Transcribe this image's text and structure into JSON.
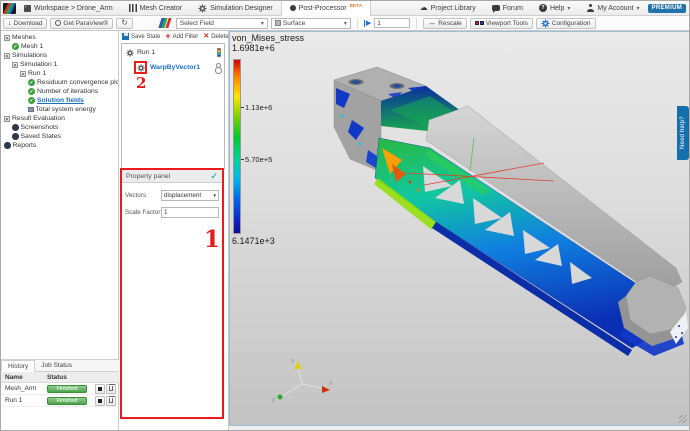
{
  "topbar": {
    "workspace_label": "Workspace > Drone_Arm",
    "tab_mesh_creator": "Mesh Creator",
    "tab_sim_designer": "Simulation Designer",
    "tab_post_processor": "Post-Processor",
    "beta_badge": "BETA",
    "project_library": "Project Library",
    "forum": "Forum",
    "help": "Help",
    "my_account": "My Account",
    "premium": "PREMIUM"
  },
  "toolbar": {
    "download": "Download",
    "get_paraview": "Get ParaView®",
    "select_field": "Select Field",
    "surface": "Surface",
    "frame_value": "1",
    "rescale": "Rescale",
    "viewport_tools": "Viewport Tools",
    "configuration": "Configuration"
  },
  "sidebar": {
    "items": [
      {
        "label": "Meshes",
        "level": 0,
        "icon": "expander"
      },
      {
        "label": "Mesh 1",
        "level": 1,
        "icon": "check"
      },
      {
        "label": "Simulations",
        "level": 0,
        "icon": "expander"
      },
      {
        "label": "Simulation 1",
        "level": 1,
        "icon": "expander"
      },
      {
        "label": "Run 1",
        "level": 2,
        "icon": "expander"
      },
      {
        "label": "Residuum convergence plot",
        "level": 3,
        "icon": "check"
      },
      {
        "label": "Number of iterations",
        "level": 3,
        "icon": "check"
      },
      {
        "label": "Solution fields",
        "level": 3,
        "icon": "check",
        "selected": true
      },
      {
        "label": "Total system energy",
        "level": 3,
        "icon": "square"
      },
      {
        "label": "Result Evaluation",
        "level": 0,
        "icon": "expander"
      },
      {
        "label": "Screenshots",
        "level": 1,
        "icon": "dot"
      },
      {
        "label": "Saved States",
        "level": 1,
        "icon": "dot"
      },
      {
        "label": "Reports",
        "level": 0,
        "icon": "dot"
      }
    ]
  },
  "filters": {
    "save_state": "Save State",
    "add_filter": "Add Filter",
    "delete_filter": "Delete Filter",
    "run_label": "Run 1",
    "warp_label": "WarpByVector1"
  },
  "property_panel": {
    "title": "Property panel",
    "vectors_label": "Vectors",
    "vectors_value": "displacement",
    "scale_label": "Scale Factor",
    "scale_value": "1"
  },
  "annotations": {
    "step1": "1",
    "step2": "2"
  },
  "history": {
    "tab_history": "History",
    "tab_job_status": "Job Status",
    "col_name": "Name",
    "col_status": "Status",
    "rows": [
      {
        "name": "Mesh_Arm",
        "status": "Finished"
      },
      {
        "name": "Run 1",
        "status": "Finished"
      }
    ]
  },
  "viewport": {
    "legend": {
      "title": "von_Mises_stress",
      "max": "1.6981e+6",
      "tick1": "1.13e+6",
      "tick2": "5.70e+5",
      "min": "6.1471e+3"
    },
    "need_help": "Need help?",
    "axes": {
      "x": "X",
      "y": "Y",
      "z": "Z"
    }
  },
  "colors": {
    "premium_blue": "#2272ab",
    "link_blue": "#1a6fc0",
    "annotation_red": "#e81c1c",
    "finished_green": "#4ea34e",
    "legend_top_red": "#d40000",
    "legend_bottom_blue": "#101090"
  }
}
